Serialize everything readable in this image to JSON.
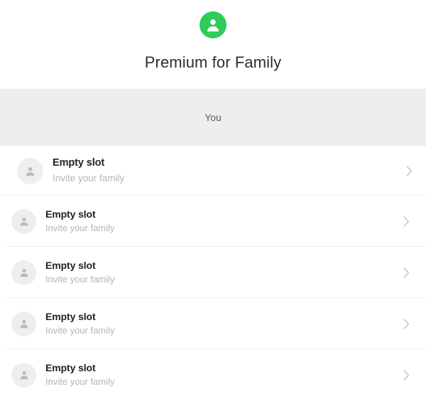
{
  "header": {
    "avatar_icon": "person-circle-icon",
    "avatar_color": "#2ecc58",
    "title": "Premium for Family"
  },
  "section": {
    "label": "You",
    "background_color": "#eeeeee"
  },
  "list": {
    "rows": [
      {
        "avatar_icon": "person-placeholder-icon",
        "title": "Empty slot",
        "subtitle": "Invite your family",
        "chevron_icon": "chevron-right-icon"
      },
      {
        "avatar_icon": "person-placeholder-icon",
        "title": "Empty slot",
        "subtitle": "Invite your family",
        "chevron_icon": "chevron-right-icon"
      },
      {
        "avatar_icon": "person-placeholder-icon",
        "title": "Empty slot",
        "subtitle": "Invite your family",
        "chevron_icon": "chevron-right-icon"
      },
      {
        "avatar_icon": "person-placeholder-icon",
        "title": "Empty slot",
        "subtitle": "Invite your family",
        "chevron_icon": "chevron-right-icon"
      },
      {
        "avatar_icon": "person-placeholder-icon",
        "title": "Empty slot",
        "subtitle": "Invite your family",
        "chevron_icon": "chevron-right-icon"
      }
    ]
  }
}
